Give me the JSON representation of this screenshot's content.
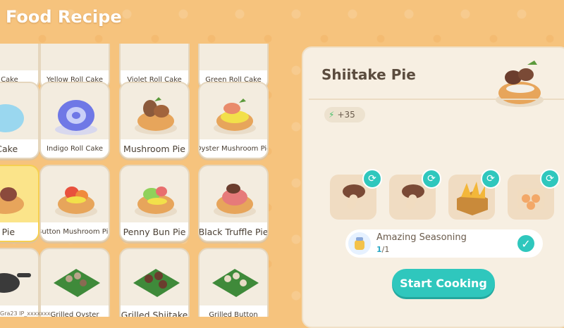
{
  "header": {
    "title": "Food Recipe"
  },
  "recipes": [
    {
      "name": "oll Cake"
    },
    {
      "name": "Yellow Roll Cake"
    },
    {
      "name": "Violet Roll Cake"
    },
    {
      "name": "Green Roll Cake"
    },
    {
      "name": "l Cake"
    },
    {
      "name": "Indigo Roll Cake"
    },
    {
      "name": "Mushroom Pie"
    },
    {
      "name": "Oyster Mushroom Pie"
    },
    {
      "name": "e Pie"
    },
    {
      "name": "Button Mushroom Pie"
    },
    {
      "name": "Penny Bun Pie"
    },
    {
      "name": "Black Truffle Pie"
    },
    {
      "name": ""
    },
    {
      "name": "Grilled Oyster"
    },
    {
      "name": "Grilled Shiitake"
    },
    {
      "name": "Grilled Button"
    }
  ],
  "detail": {
    "title": "Shiitake Pie",
    "energy": "+35",
    "ingredients": [
      {
        "icon": "mushroom-icon"
      },
      {
        "icon": "mushroom-icon"
      },
      {
        "icon": "crate-of-grain-icon"
      },
      {
        "icon": "basket-of-eggs-icon"
      }
    ],
    "seasoning": {
      "name": "Amazing Seasoning",
      "current": "1",
      "total": "/1"
    },
    "start_button": "Start Cooking"
  },
  "watermark": "Gra23  IP_xxxxxxx",
  "colors": {
    "accent": "#2fc7bd",
    "background": "#f6c37d",
    "panel": "#f7efe2"
  }
}
